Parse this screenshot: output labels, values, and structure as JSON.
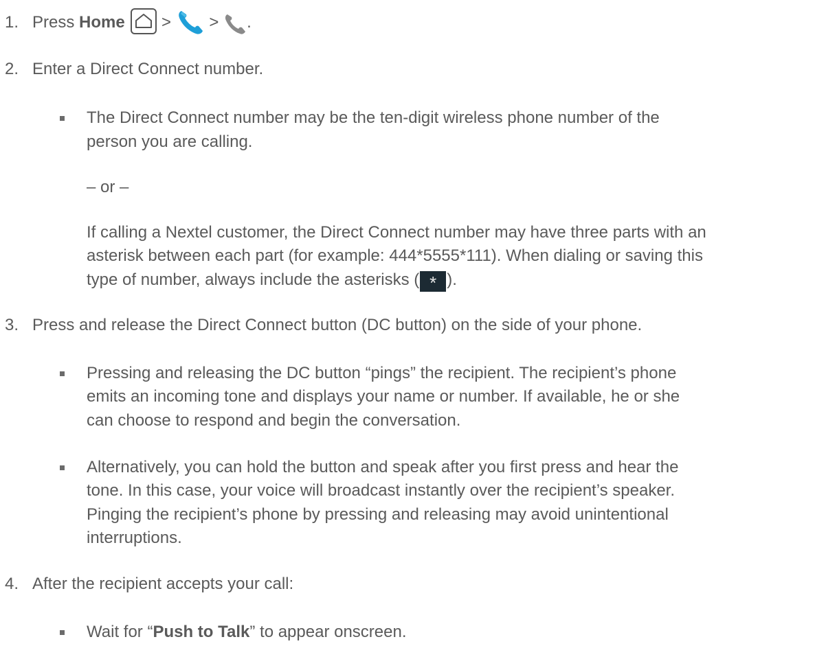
{
  "steps": [
    {
      "number": "1.",
      "text_prefix": "Press ",
      "bold": "Home",
      "sep1": " > ",
      "sep2": " > ",
      "end": "."
    },
    {
      "number": "2.",
      "text": "Enter a Direct Connect number.",
      "bullet1_line1": "The Direct Connect number may be the ten-digit wireless phone number of the",
      "bullet1_line2": "person you are calling.",
      "or": "– or –",
      "para_line1": "If calling a Nextel customer, the Direct Connect number may have three parts with an",
      "para_line2": "asterisk between each part (for example: 444*5555*111). When dialing or saving this",
      "para_line3_prefix": "type of number, always include the asterisks (",
      "para_line3_suffix": ")."
    },
    {
      "number": "3.",
      "text": "Press and release the Direct Connect button (DC button) on the side of your phone.",
      "bullet1_lines": [
        "Pressing and releasing the DC button “pings” the recipient. The recipient’s phone",
        "emits an incoming tone and displays your name or number. If available, he or she",
        "can choose to respond and begin the conversation."
      ],
      "bullet2_lines": [
        "Alternatively, you can hold the button and speak after you first press and hear the",
        "tone. In this case, your voice will broadcast instantly over the recipient’s speaker.",
        "Pinging the recipient’s phone by pressing and releasing may avoid unintentional",
        "interruptions."
      ]
    },
    {
      "number": "4.",
      "text": "After the recipient accepts your call:",
      "bullet_prefix": "Wait for “",
      "bullet_bold": "Push to Talk",
      "bullet_suffix": "” to appear onscreen."
    }
  ],
  "icons": {
    "home": "home-icon",
    "phone_app": "phone-app-icon",
    "phone_dial": "phone-dial-icon",
    "asterisk": "asterisk-key-icon",
    "asterisk_glyph": "*"
  },
  "colors": {
    "text": "#5a5a5a",
    "phone_blue": "#1e9fd8",
    "phone_gray": "#8a8a8a",
    "key_bg": "#1c2a33"
  }
}
